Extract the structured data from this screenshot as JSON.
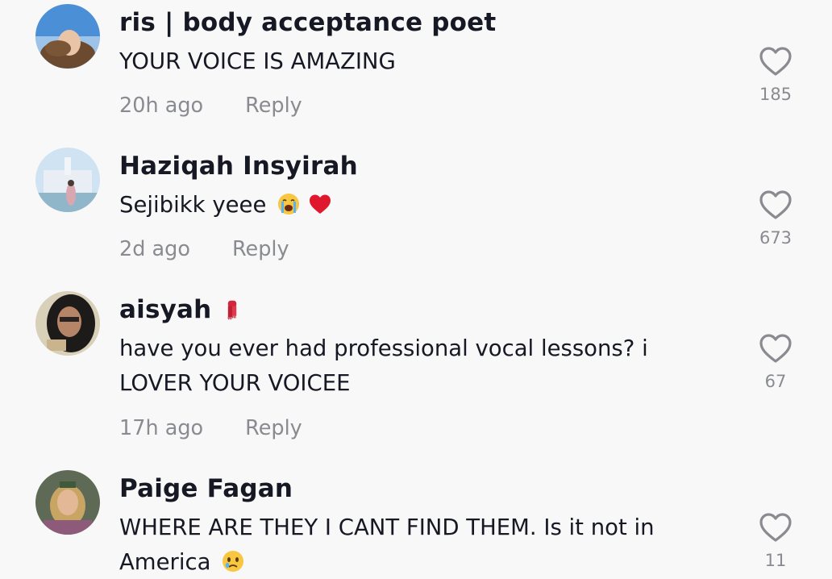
{
  "comments": [
    {
      "username": "ris | body acceptance poet",
      "text": "YOUR VOICE IS AMAZING",
      "time": "20h ago",
      "reply_label": "Reply",
      "likes": "185"
    },
    {
      "username": "Haziqah Insyirah",
      "text": "Sejibikk yeee",
      "time": "2d ago",
      "reply_label": "Reply",
      "likes": "673"
    },
    {
      "username": "aisyah",
      "text": "have you ever had professional vocal lessons? i LOVER YOUR VOICEE",
      "time": "17h ago",
      "reply_label": "Reply",
      "likes": "67"
    },
    {
      "username": "Paige Fagan",
      "text": "WHERE ARE THEY I CANT FIND THEM. Is it not in America",
      "likes": "11"
    }
  ],
  "colors": {
    "background": "#f8f8f8",
    "text_primary": "#161823",
    "text_secondary": "#8a8b91"
  }
}
